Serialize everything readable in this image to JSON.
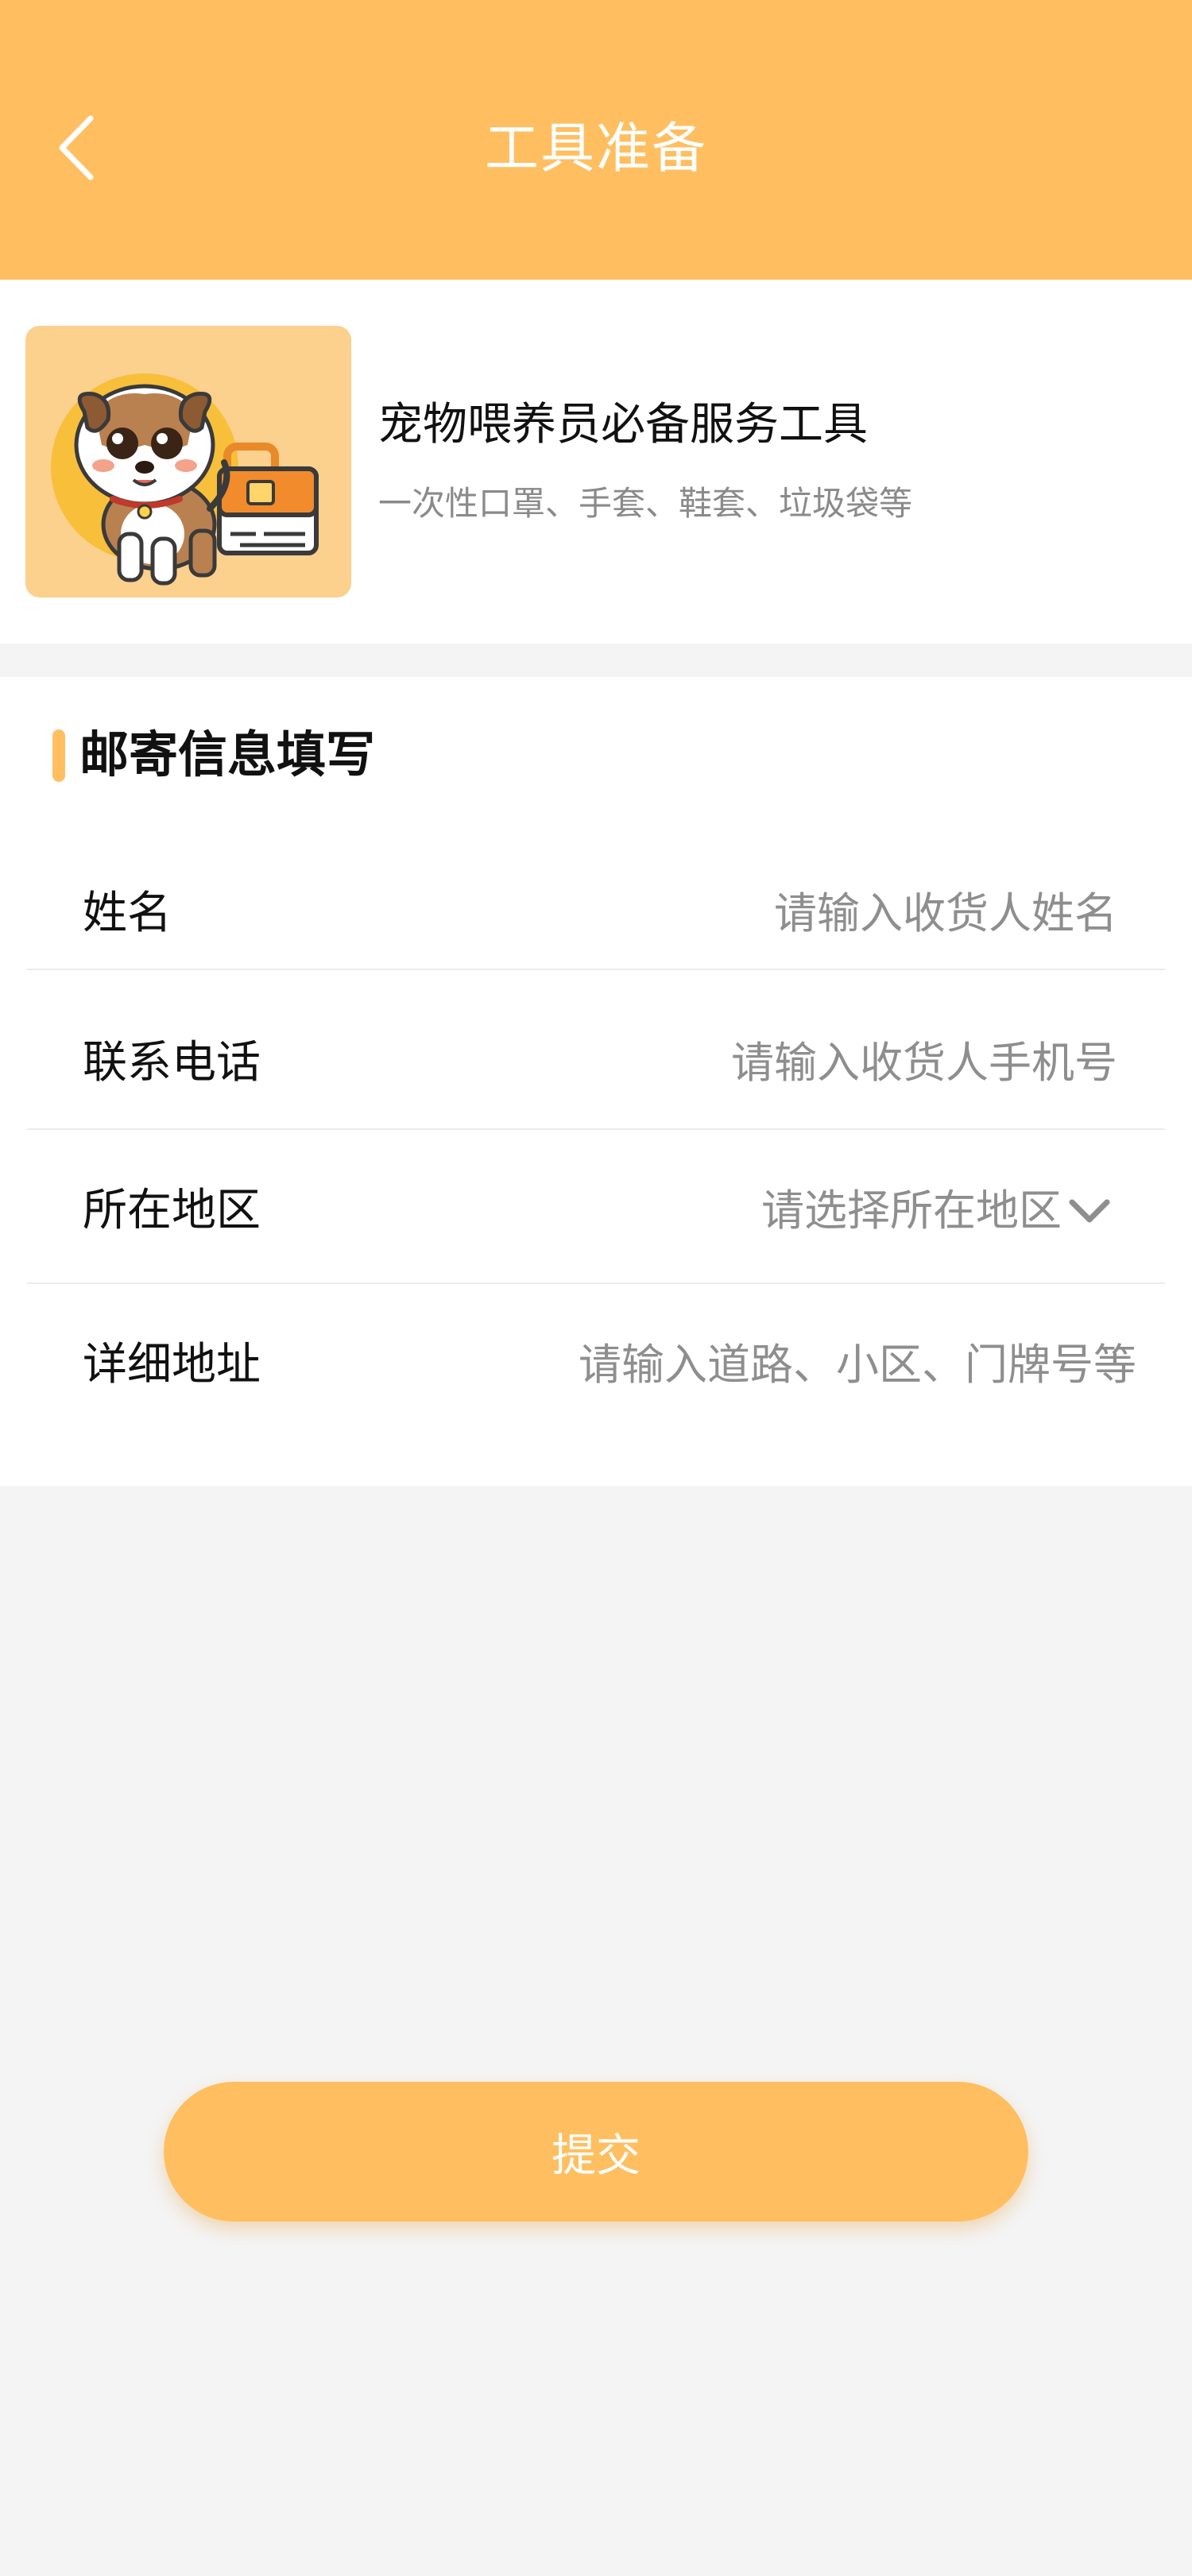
{
  "header": {
    "title": "工具准备"
  },
  "product": {
    "title": "宠物喂养员必备服务工具",
    "description": "一次性口罩、手套、鞋套、垃圾袋等"
  },
  "form": {
    "section_title": "邮寄信息填写",
    "fields": [
      {
        "label": "姓名",
        "placeholder": "请输入收货人姓名"
      },
      {
        "label": "联系电话",
        "placeholder": "请输入收货人手机号"
      },
      {
        "label": "所在地区",
        "placeholder": "请选择所在地区"
      },
      {
        "label": "详细地址",
        "placeholder": "请输入道路、小区、门牌号等"
      }
    ]
  },
  "submit_label": "提交",
  "colors": {
    "primary": "#ffbf61",
    "background": "#f4f4f4",
    "text": "#111111",
    "placeholder": "#8e8e8e"
  }
}
